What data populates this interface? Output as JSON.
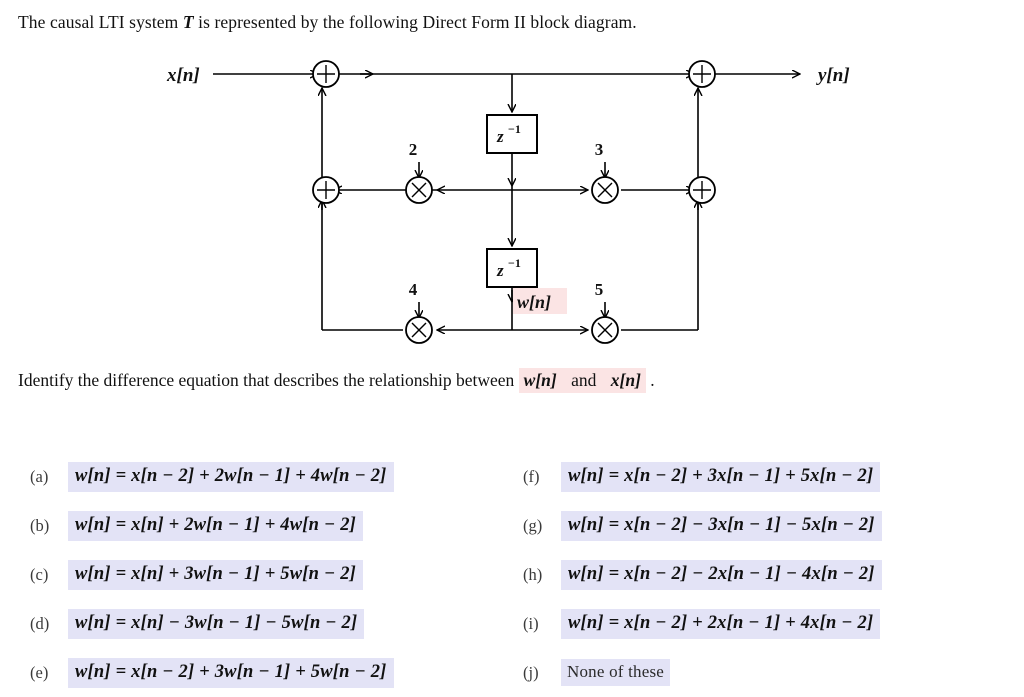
{
  "intro": {
    "before_symbol": "The causal LTI system ",
    "symbol": "T",
    "after_symbol": " is represented by the following Direct Form II block diagram."
  },
  "diagram": {
    "input_label": "x[n]",
    "output_label": "y[n]",
    "intermediate_label": "w[n]",
    "delay_label_top": "z",
    "delay_exponent_top": "−1",
    "delay_label_bottom": "z",
    "delay_exponent_bottom": "−1",
    "gains": {
      "top_left": "2",
      "top_right": "3",
      "bottom_left": "4",
      "bottom_right": "5"
    },
    "adder_symbol": "+",
    "multiplier_symbol": "×",
    "highlight_color": "#fbe4e4",
    "line_color": "#000000"
  },
  "question": {
    "text_before": "Identify the difference equation that describes the relationship between ",
    "var_w": "w[n]",
    "text_between": " and ",
    "var_x": "x[n]",
    "text_after": " ."
  },
  "options": {
    "highlight_color": "#e3e3f6",
    "left": [
      {
        "tag": "(a)",
        "text": "w[n] = x[n − 2] + 2w[n − 1] + 4w[n − 2]"
      },
      {
        "tag": "(b)",
        "text": "w[n] = x[n] + 2w[n − 1] + 4w[n − 2]"
      },
      {
        "tag": "(c)",
        "text": "w[n] = x[n] + 3w[n − 1] + 5w[n − 2]"
      },
      {
        "tag": "(d)",
        "text": "w[n] = x[n] − 3w[n − 1] − 5w[n − 2]"
      },
      {
        "tag": "(e)",
        "text": "w[n] = x[n − 2] + 3w[n − 1] + 5w[n − 2]"
      }
    ],
    "right": [
      {
        "tag": "(f)",
        "text": "w[n] = x[n − 2] + 3x[n − 1] + 5x[n − 2]"
      },
      {
        "tag": "(g)",
        "text": "w[n] = x[n − 2] − 3x[n − 1] − 5x[n − 2]"
      },
      {
        "tag": "(h)",
        "text": "w[n] = x[n − 2] − 2x[n − 1] − 4x[n − 2]"
      },
      {
        "tag": "(i)",
        "text": "w[n] = x[n − 2] + 2x[n − 1] + 4x[n − 2]"
      },
      {
        "tag": "(j)",
        "text": "None of these",
        "plain": true
      }
    ]
  }
}
